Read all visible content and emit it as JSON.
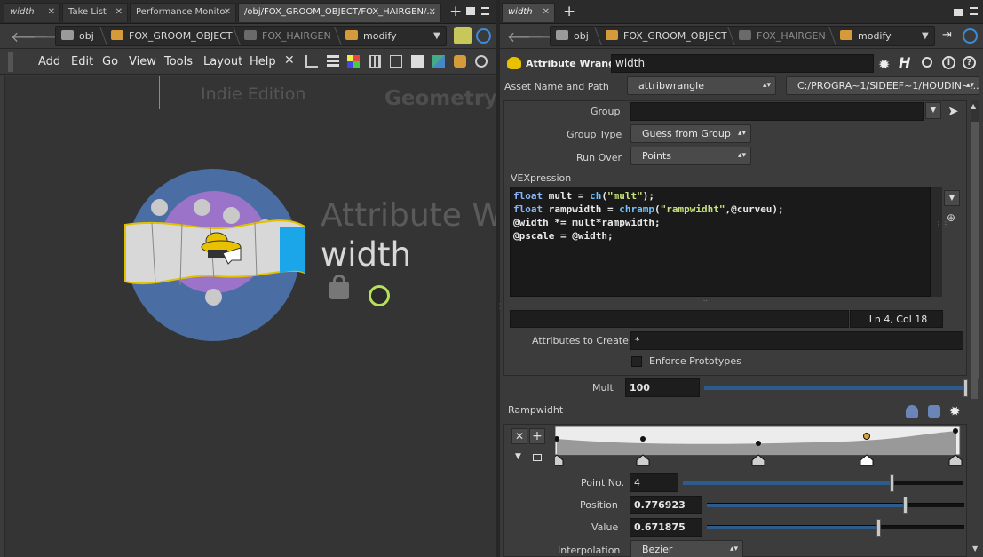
{
  "left_pane": {
    "tabs": [
      {
        "label": "width"
      },
      {
        "label": "Take List"
      },
      {
        "label": "Performance Monitor"
      },
      {
        "label": "/obj/FOX_GROOM_OBJECT/FOX_HAIRGEN/..."
      }
    ],
    "tab_add_icon": "plus-icon",
    "path": {
      "obj": "obj",
      "groom": "FOX_GROOM_OBJECT",
      "hairgen": "FOX_HAIRGEN",
      "modify": "modify"
    },
    "menu": [
      "Add",
      "Edit",
      "Go",
      "View",
      "Tools",
      "Layout",
      "Help"
    ],
    "watermark": {
      "edition": "Indie Edition",
      "context": "Geometry"
    },
    "node": {
      "type_label": "Attribute Wr",
      "name": "width"
    }
  },
  "right_pane": {
    "tabs": [
      {
        "label": "width"
      }
    ],
    "path": {
      "obj": "obj",
      "groom": "FOX_GROOM_OBJECT",
      "hairgen": "FOX_HAIRGEN",
      "modify": "modify"
    },
    "header": {
      "node_type": "Attribute Wrangle",
      "node_name": "width"
    },
    "asset": {
      "label": "Asset Name and Path",
      "name": "attribwrangle",
      "path": "C:/PROGRA~1/SIDEEF~1/HOUDIN~..."
    },
    "group": {
      "label": "Group",
      "value": ""
    },
    "group_type": {
      "label": "Group Type",
      "value": "Guess from Group"
    },
    "run_over": {
      "label": "Run Over",
      "value": "Points"
    },
    "vex": {
      "label": "VEXpression",
      "lines": [
        "float mult = ch(\"mult\");",
        "float rampwidth = chramp(\"rampwidht\",@curveu);",
        "@width *= mult*rampwidth;",
        "@pscale = @width;"
      ],
      "status": "Ln 4, Col 18"
    },
    "attributes_to_create": {
      "label": "Attributes to Create",
      "value": "*"
    },
    "enforce_prototypes": {
      "label": "Enforce Prototypes",
      "checked": false
    },
    "mult": {
      "label": "Mult",
      "value": "100",
      "fraction": 1.0
    },
    "ramp": {
      "label": "Rampwidht",
      "point_no": {
        "label": "Point No.",
        "value": "4",
        "fraction": 0.75
      },
      "position": {
        "label": "Position",
        "value": "0.776923",
        "fraction": 0.776923
      },
      "value": {
        "label": "Value",
        "value": "0.671875",
        "fraction": 0.671875
      },
      "interpolation": {
        "label": "Interpolation",
        "value": "Bezier"
      }
    }
  }
}
